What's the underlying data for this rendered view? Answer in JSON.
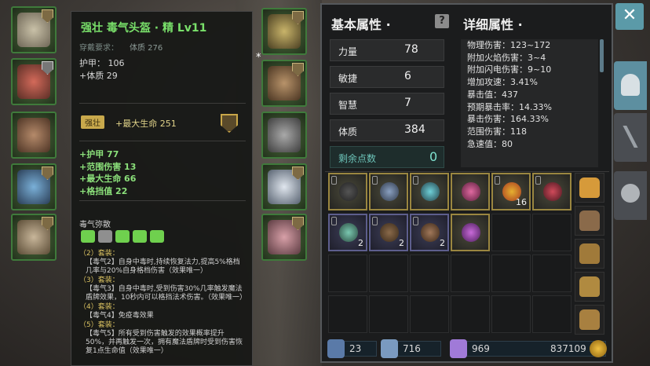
{
  "tooltip": {
    "item_name": "强壮 毒气头盔 · 精 Lv11",
    "requirement_label": "穿戴要求：",
    "requirement_value": "体质 276",
    "base_stats": [
      "护甲： 106",
      "+体质 29"
    ],
    "quality_badge": "强壮",
    "quality_stat": "+最大生命 251",
    "extra_stats": [
      "+护甲 77",
      "+范围伤害 13",
      "+最大生命 66",
      "+格挡值 22"
    ],
    "set_name": "毒气弥散",
    "set_bonuses": [
      {
        "header": "（2）套装：",
        "text": "【毒气2】自身中毒时,持续恢复法力,提高5%格档几率与20%自身格档伤害（效果唯一）"
      },
      {
        "header": "（3）套装：",
        "text": "【毒气3】自身中毒时,受到伤害30%几率触发魔法盾牌效果，10秒内可以格挡法术伤害。（效果唯一）"
      },
      {
        "header": "（4）套装：",
        "text": "【毒气4】免疫毒效果"
      },
      {
        "header": "（5）套装：",
        "text": "【毒气5】所有受到伤害触发的效果概率提升50%，并再触发一次，拥有魔法盾牌时受到伤害恢复1点生命值（效果唯一）"
      }
    ]
  },
  "mid_marker": "*",
  "basic": {
    "title": "基本属性 ·",
    "help_icon": "?",
    "rows": [
      {
        "label": "力量",
        "value": "78"
      },
      {
        "label": "敏捷",
        "value": "6"
      },
      {
        "label": "智慧",
        "value": "7"
      },
      {
        "label": "体质",
        "value": "384"
      }
    ],
    "points_label": "剩余点数",
    "points_value": "0"
  },
  "detail": {
    "title": "详细属性 ·",
    "stats": [
      "物理伤害：123~172",
      "附加火焰伤害：3~4",
      "附加闪电伤害：9~10",
      "增加攻速：3.41%",
      "暴击值：437",
      "预期暴击率：14.33%",
      "暴击伤害：164.33%",
      "范围伤害：118",
      "急速值：80"
    ]
  },
  "inventory": {
    "counts": {
      "r1c6": "16",
      "r2c1": "2",
      "r2c2": "2",
      "r2c3": "2"
    }
  },
  "currency": {
    "swords": "23",
    "gems": "716",
    "crystals": "969",
    "gold": "837109"
  },
  "close_label": "✕",
  "colors": {
    "accent": "#5d8fa0",
    "set_green": "#8be07a",
    "gold": "#c9a94c"
  }
}
